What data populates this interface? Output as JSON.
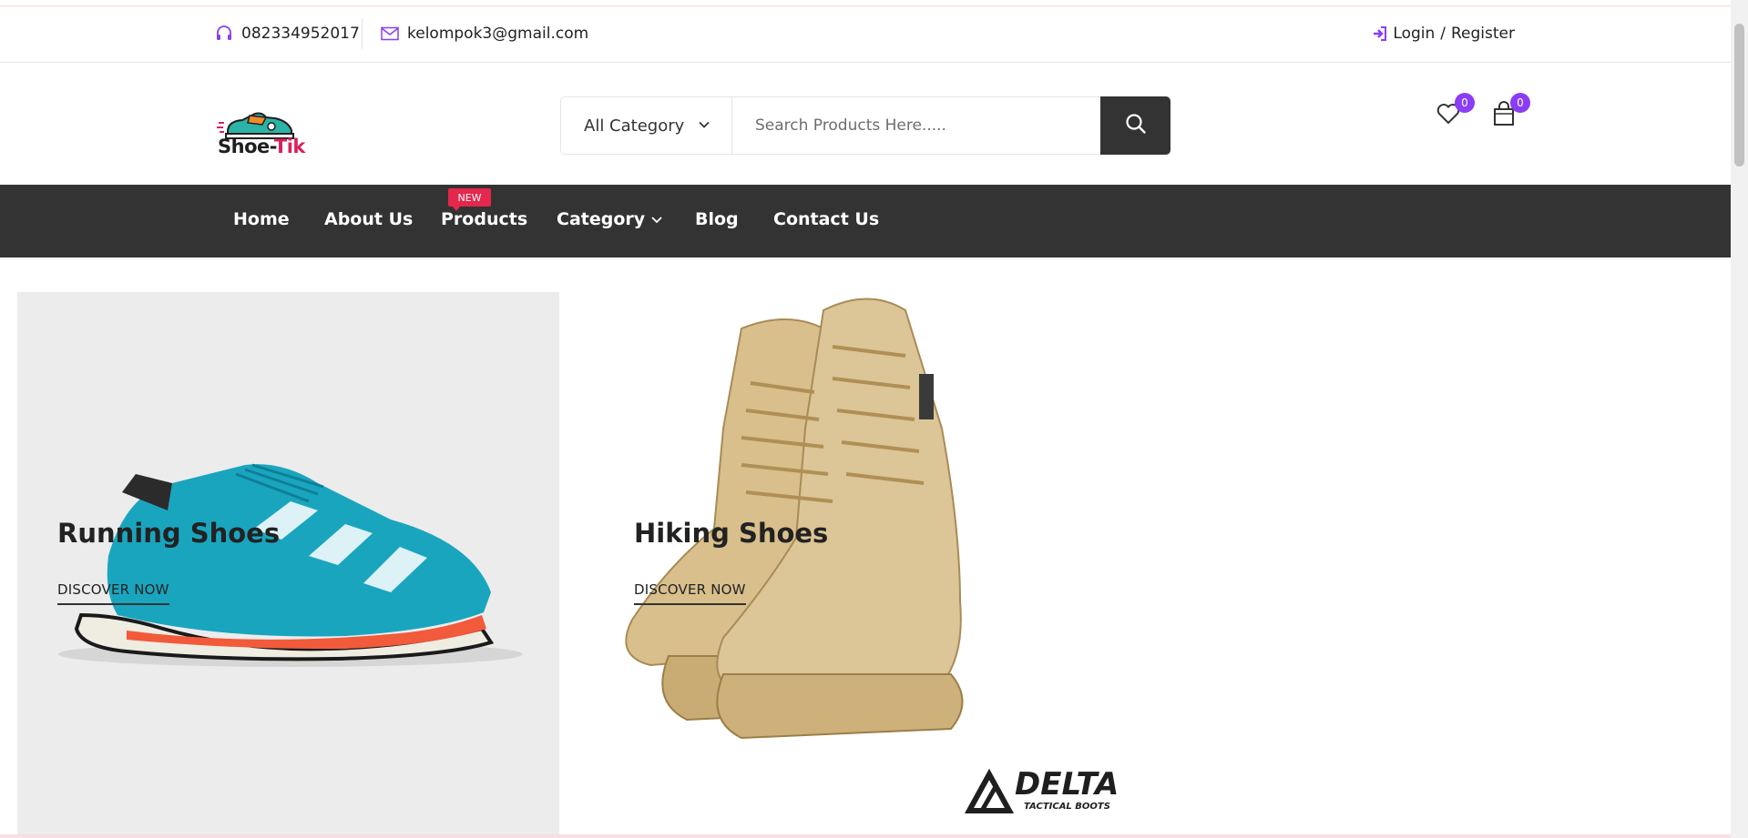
{
  "topbar": {
    "phone": "082334952017",
    "email": "kelompok3@gmail.com",
    "login_label": "Login",
    "separator": "/",
    "register_label": "Register",
    "accent_color": "#8a3df5"
  },
  "header": {
    "logo": {
      "part1": "Shoe-",
      "part2": "Tik"
    },
    "search": {
      "category_selected": "All Category",
      "placeholder": "Search Products Here....."
    },
    "wishlist_count": "0",
    "cart_count": "0"
  },
  "nav": {
    "items": [
      {
        "label": "Home"
      },
      {
        "label": "About Us"
      },
      {
        "label": "Products",
        "badge": "NEW"
      },
      {
        "label": "Category"
      },
      {
        "label": "Blog"
      },
      {
        "label": "Contact Us"
      }
    ]
  },
  "banners": [
    {
      "title": "Running Shoes",
      "link": "DISCOVER NOW"
    },
    {
      "title": "Hiking Shoes",
      "link": "DISCOVER NOW",
      "brand": "DELTA",
      "brand_sub": "TACTICAL BOOTS"
    }
  ]
}
